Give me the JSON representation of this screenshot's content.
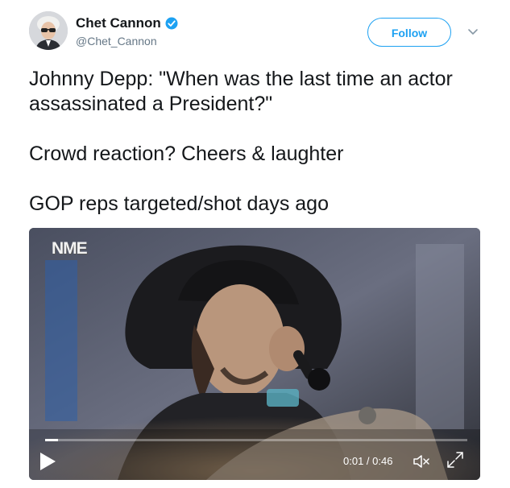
{
  "author": {
    "display_name": "Chet Cannon",
    "handle": "@Chet_Cannon",
    "verified_icon": "verified-badge-icon",
    "avatar_icon": "avatar"
  },
  "actions": {
    "follow_label": "Follow",
    "caret_icon": "chevron-down-icon"
  },
  "tweet": {
    "lines": [
      "Johnny Depp: \"When was the last time an actor assassinated a President?\"",
      "Crowd reaction? Cheers & laughter",
      "GOP reps targeted/shot days ago"
    ]
  },
  "video": {
    "watermark": "NME",
    "current_time": "0:01",
    "separator": " / ",
    "duration": "0:46",
    "progress_fraction": 0.03,
    "icons": [
      "play-icon",
      "mute-icon",
      "fullscreen-icon"
    ]
  },
  "colors": {
    "accent": "#1da1f2",
    "text": "#14171a",
    "secondary_text": "#657786"
  }
}
